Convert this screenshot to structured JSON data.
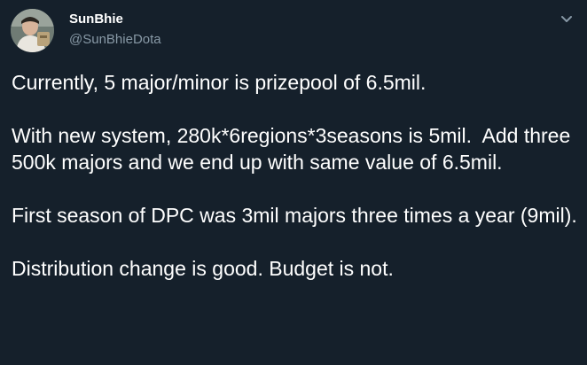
{
  "author": {
    "display_name": "SunBhie",
    "handle": "@SunBhieDota"
  },
  "icons": {
    "avatar": "profile-photo",
    "menu": "chevron-down-icon"
  },
  "colors": {
    "background": "#15202b",
    "text": "#ffffff",
    "secondary_text": "#8899a6"
  },
  "tweet": {
    "paragraphs": [
      "Currently, 5 major/minor is prizepool of 6.5mil.",
      "With new system, 280k*6regions*3seasons is 5mil.  Add three 500k majors and we end up with same value of 6.5mil.",
      "First season of DPC was 3mil majors three times a year (9mil).",
      "Distribution change is good. Budget is not."
    ]
  }
}
